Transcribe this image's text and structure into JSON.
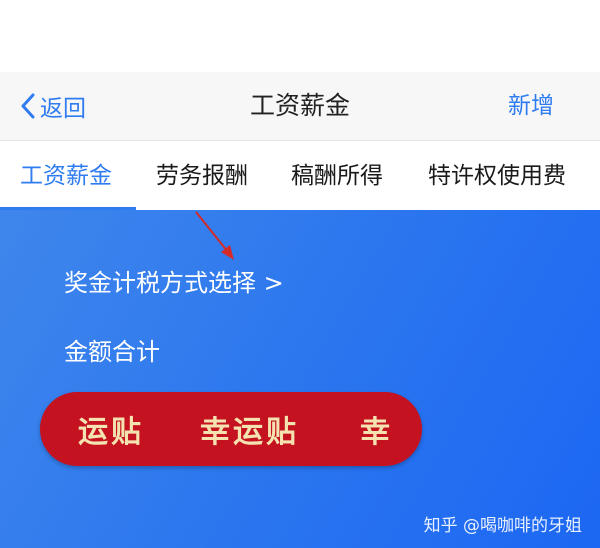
{
  "nav": {
    "back_label": "返回",
    "title": "工资薪金",
    "add_label": "新增"
  },
  "tabs": [
    {
      "label": "工资薪金",
      "active": true
    },
    {
      "label": "劳务报酬",
      "active": false
    },
    {
      "label": "稿酬所得",
      "active": false
    },
    {
      "label": "特许权使用费",
      "active": false
    }
  ],
  "hero": {
    "bonus_tax_method": "奖金计税方式选择 >",
    "amount_total_label": "金额合计"
  },
  "sticker": {
    "parts": [
      "运贴",
      "幸运贴",
      "幸"
    ]
  },
  "watermark": "知乎 @喝咖啡的牙姐",
  "colors": {
    "accent": "#2f7cf0",
    "hero_gradient_start": "#3f86ec",
    "hero_gradient_end": "#1c67f3",
    "sticker_red": "#c41220",
    "annotation_red": "#d42a2a"
  }
}
